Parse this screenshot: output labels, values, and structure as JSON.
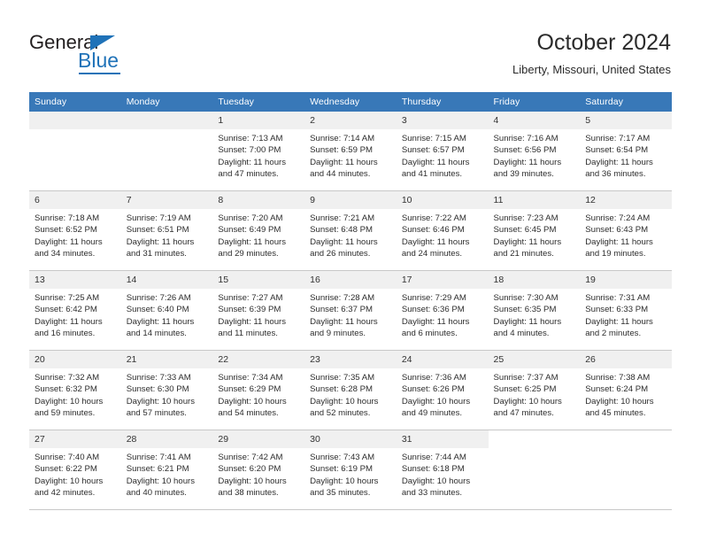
{
  "brand": {
    "name_part1": "General",
    "name_part2": "Blue"
  },
  "header": {
    "title": "October 2024",
    "location": "Liberty, Missouri, United States"
  },
  "colors": {
    "header_row": "#3878b8",
    "brand_blue": "#1f72b8",
    "daynum_band": "#f0f0f0",
    "grid_line": "#c8c8c8"
  },
  "weekdays": [
    "Sunday",
    "Monday",
    "Tuesday",
    "Wednesday",
    "Thursday",
    "Friday",
    "Saturday"
  ],
  "weeks": [
    [
      {
        "day": "",
        "empty": true
      },
      {
        "day": "",
        "empty": true
      },
      {
        "day": "1",
        "sunrise": "Sunrise: 7:13 AM",
        "sunset": "Sunset: 7:00 PM",
        "daylight1": "Daylight: 11 hours",
        "daylight2": "and 47 minutes."
      },
      {
        "day": "2",
        "sunrise": "Sunrise: 7:14 AM",
        "sunset": "Sunset: 6:59 PM",
        "daylight1": "Daylight: 11 hours",
        "daylight2": "and 44 minutes."
      },
      {
        "day": "3",
        "sunrise": "Sunrise: 7:15 AM",
        "sunset": "Sunset: 6:57 PM",
        "daylight1": "Daylight: 11 hours",
        "daylight2": "and 41 minutes."
      },
      {
        "day": "4",
        "sunrise": "Sunrise: 7:16 AM",
        "sunset": "Sunset: 6:56 PM",
        "daylight1": "Daylight: 11 hours",
        "daylight2": "and 39 minutes."
      },
      {
        "day": "5",
        "sunrise": "Sunrise: 7:17 AM",
        "sunset": "Sunset: 6:54 PM",
        "daylight1": "Daylight: 11 hours",
        "daylight2": "and 36 minutes."
      }
    ],
    [
      {
        "day": "6",
        "sunrise": "Sunrise: 7:18 AM",
        "sunset": "Sunset: 6:52 PM",
        "daylight1": "Daylight: 11 hours",
        "daylight2": "and 34 minutes."
      },
      {
        "day": "7",
        "sunrise": "Sunrise: 7:19 AM",
        "sunset": "Sunset: 6:51 PM",
        "daylight1": "Daylight: 11 hours",
        "daylight2": "and 31 minutes."
      },
      {
        "day": "8",
        "sunrise": "Sunrise: 7:20 AM",
        "sunset": "Sunset: 6:49 PM",
        "daylight1": "Daylight: 11 hours",
        "daylight2": "and 29 minutes."
      },
      {
        "day": "9",
        "sunrise": "Sunrise: 7:21 AM",
        "sunset": "Sunset: 6:48 PM",
        "daylight1": "Daylight: 11 hours",
        "daylight2": "and 26 minutes."
      },
      {
        "day": "10",
        "sunrise": "Sunrise: 7:22 AM",
        "sunset": "Sunset: 6:46 PM",
        "daylight1": "Daylight: 11 hours",
        "daylight2": "and 24 minutes."
      },
      {
        "day": "11",
        "sunrise": "Sunrise: 7:23 AM",
        "sunset": "Sunset: 6:45 PM",
        "daylight1": "Daylight: 11 hours",
        "daylight2": "and 21 minutes."
      },
      {
        "day": "12",
        "sunrise": "Sunrise: 7:24 AM",
        "sunset": "Sunset: 6:43 PM",
        "daylight1": "Daylight: 11 hours",
        "daylight2": "and 19 minutes."
      }
    ],
    [
      {
        "day": "13",
        "sunrise": "Sunrise: 7:25 AM",
        "sunset": "Sunset: 6:42 PM",
        "daylight1": "Daylight: 11 hours",
        "daylight2": "and 16 minutes."
      },
      {
        "day": "14",
        "sunrise": "Sunrise: 7:26 AM",
        "sunset": "Sunset: 6:40 PM",
        "daylight1": "Daylight: 11 hours",
        "daylight2": "and 14 minutes."
      },
      {
        "day": "15",
        "sunrise": "Sunrise: 7:27 AM",
        "sunset": "Sunset: 6:39 PM",
        "daylight1": "Daylight: 11 hours",
        "daylight2": "and 11 minutes."
      },
      {
        "day": "16",
        "sunrise": "Sunrise: 7:28 AM",
        "sunset": "Sunset: 6:37 PM",
        "daylight1": "Daylight: 11 hours",
        "daylight2": "and 9 minutes."
      },
      {
        "day": "17",
        "sunrise": "Sunrise: 7:29 AM",
        "sunset": "Sunset: 6:36 PM",
        "daylight1": "Daylight: 11 hours",
        "daylight2": "and 6 minutes."
      },
      {
        "day": "18",
        "sunrise": "Sunrise: 7:30 AM",
        "sunset": "Sunset: 6:35 PM",
        "daylight1": "Daylight: 11 hours",
        "daylight2": "and 4 minutes."
      },
      {
        "day": "19",
        "sunrise": "Sunrise: 7:31 AM",
        "sunset": "Sunset: 6:33 PM",
        "daylight1": "Daylight: 11 hours",
        "daylight2": "and 2 minutes."
      }
    ],
    [
      {
        "day": "20",
        "sunrise": "Sunrise: 7:32 AM",
        "sunset": "Sunset: 6:32 PM",
        "daylight1": "Daylight: 10 hours",
        "daylight2": "and 59 minutes."
      },
      {
        "day": "21",
        "sunrise": "Sunrise: 7:33 AM",
        "sunset": "Sunset: 6:30 PM",
        "daylight1": "Daylight: 10 hours",
        "daylight2": "and 57 minutes."
      },
      {
        "day": "22",
        "sunrise": "Sunrise: 7:34 AM",
        "sunset": "Sunset: 6:29 PM",
        "daylight1": "Daylight: 10 hours",
        "daylight2": "and 54 minutes."
      },
      {
        "day": "23",
        "sunrise": "Sunrise: 7:35 AM",
        "sunset": "Sunset: 6:28 PM",
        "daylight1": "Daylight: 10 hours",
        "daylight2": "and 52 minutes."
      },
      {
        "day": "24",
        "sunrise": "Sunrise: 7:36 AM",
        "sunset": "Sunset: 6:26 PM",
        "daylight1": "Daylight: 10 hours",
        "daylight2": "and 49 minutes."
      },
      {
        "day": "25",
        "sunrise": "Sunrise: 7:37 AM",
        "sunset": "Sunset: 6:25 PM",
        "daylight1": "Daylight: 10 hours",
        "daylight2": "and 47 minutes."
      },
      {
        "day": "26",
        "sunrise": "Sunrise: 7:38 AM",
        "sunset": "Sunset: 6:24 PM",
        "daylight1": "Daylight: 10 hours",
        "daylight2": "and 45 minutes."
      }
    ],
    [
      {
        "day": "27",
        "sunrise": "Sunrise: 7:40 AM",
        "sunset": "Sunset: 6:22 PM",
        "daylight1": "Daylight: 10 hours",
        "daylight2": "and 42 minutes."
      },
      {
        "day": "28",
        "sunrise": "Sunrise: 7:41 AM",
        "sunset": "Sunset: 6:21 PM",
        "daylight1": "Daylight: 10 hours",
        "daylight2": "and 40 minutes."
      },
      {
        "day": "29",
        "sunrise": "Sunrise: 7:42 AM",
        "sunset": "Sunset: 6:20 PM",
        "daylight1": "Daylight: 10 hours",
        "daylight2": "and 38 minutes."
      },
      {
        "day": "30",
        "sunrise": "Sunrise: 7:43 AM",
        "sunset": "Sunset: 6:19 PM",
        "daylight1": "Daylight: 10 hours",
        "daylight2": "and 35 minutes."
      },
      {
        "day": "31",
        "sunrise": "Sunrise: 7:44 AM",
        "sunset": "Sunset: 6:18 PM",
        "daylight1": "Daylight: 10 hours",
        "daylight2": "and 33 minutes."
      },
      {
        "day": "",
        "blank": true
      },
      {
        "day": "",
        "blank": true
      }
    ]
  ]
}
